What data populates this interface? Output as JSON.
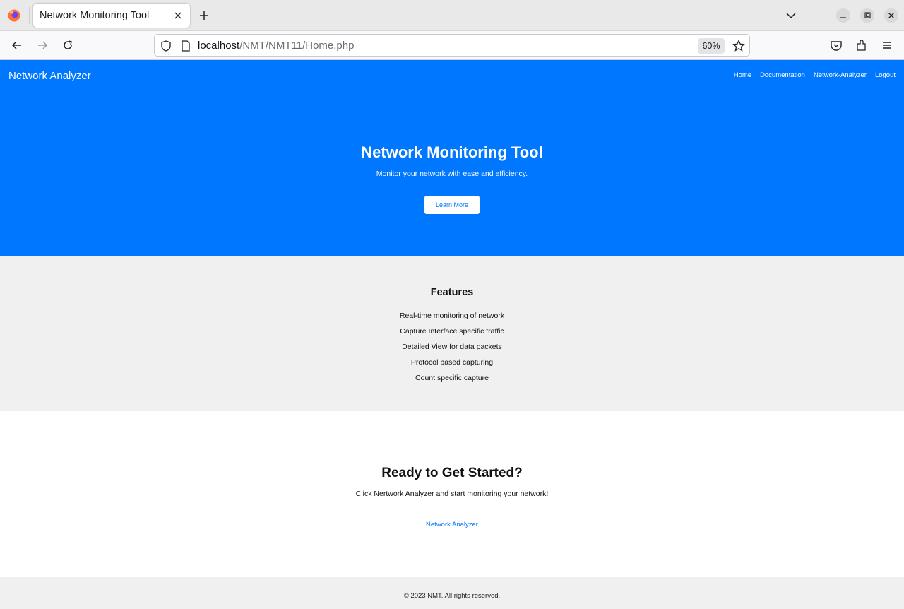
{
  "browser": {
    "tab_title": "Network Monitoring Tool",
    "url_host": "localhost",
    "url_path": "/NMT/NMT11/Home.php",
    "zoom": "60%",
    "icons": [
      "firefox-logo",
      "tab-close",
      "new-tab",
      "tab-list",
      "minimize",
      "maximize",
      "close",
      "back",
      "forward",
      "reload",
      "shield",
      "page",
      "bookmark-star",
      "pocket",
      "extensions",
      "menu"
    ]
  },
  "site": {
    "brand": "Network Analyzer",
    "nav": [
      "Home",
      "Documentation",
      "Network-Analyzer",
      "Logout"
    ],
    "hero": {
      "title": "Network Monitoring Tool",
      "subtitle": "Monitor your network with ease and efficiency.",
      "button": "Learn More"
    },
    "features": {
      "title": "Features",
      "items": [
        "Real-time monitoring of network",
        "Capture Interface specific traffic",
        "Detailed View for data packets",
        "Protocol based capturing",
        "Count specific capture"
      ]
    },
    "cta": {
      "title": "Ready to Get Started?",
      "text": "Click Nertwork Analyzer and start monitoring your network!",
      "link": "Network Analyzer"
    },
    "footer": "© 2023 NMT. All rights reserved."
  },
  "colors": {
    "primary": "#0077ff",
    "section_bg": "#f0f0f0",
    "chrome_bg": "#e9e9ea"
  }
}
